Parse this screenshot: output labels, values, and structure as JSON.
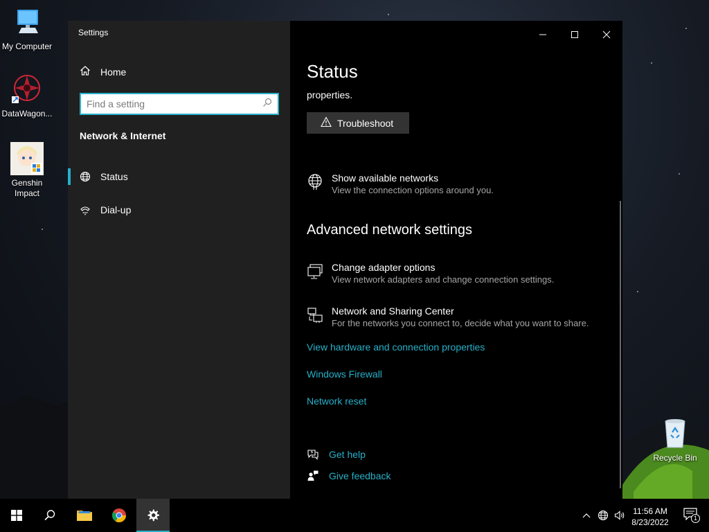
{
  "desktop": {
    "icons": [
      {
        "label": "My Computer"
      },
      {
        "label": "DataWagon..."
      },
      {
        "label": "Genshin Impact"
      },
      {
        "label": "Recycle Bin"
      }
    ]
  },
  "window": {
    "title": "Settings",
    "controls": {
      "minimize": "minimize-icon",
      "maximize": "maximize-icon",
      "close": "close-icon"
    }
  },
  "sidebar": {
    "home_label": "Home",
    "search_placeholder": "Find a setting",
    "section_title": "Network & Internet",
    "items": [
      {
        "label": "Status",
        "icon": "globe-icon",
        "active": true
      },
      {
        "label": "Dial-up",
        "icon": "dialup-icon",
        "active": false
      }
    ]
  },
  "content": {
    "page_title": "Status",
    "fragment_text": "properties.",
    "troubleshoot_label": "Troubleshoot",
    "show_networks": {
      "title": "Show available networks",
      "desc": "View the connection options around you."
    },
    "advanced_heading": "Advanced network settings",
    "adapter": {
      "title": "Change adapter options",
      "desc": "View network adapters and change connection settings."
    },
    "sharing": {
      "title": "Network and Sharing Center",
      "desc": "For the networks you connect to, decide what you want to share."
    },
    "links": [
      "View hardware and connection properties",
      "Windows Firewall",
      "Network reset"
    ],
    "help": {
      "get_help": "Get help",
      "give_feedback": "Give feedback"
    }
  },
  "taskbar": {
    "time": "11:56 AM",
    "date": "8/23/2022",
    "notification_count": "1"
  },
  "colors": {
    "accent": "#27b0c9",
    "sidebar_bg": "#202020",
    "content_bg": "#000000",
    "button_bg": "#333333"
  }
}
